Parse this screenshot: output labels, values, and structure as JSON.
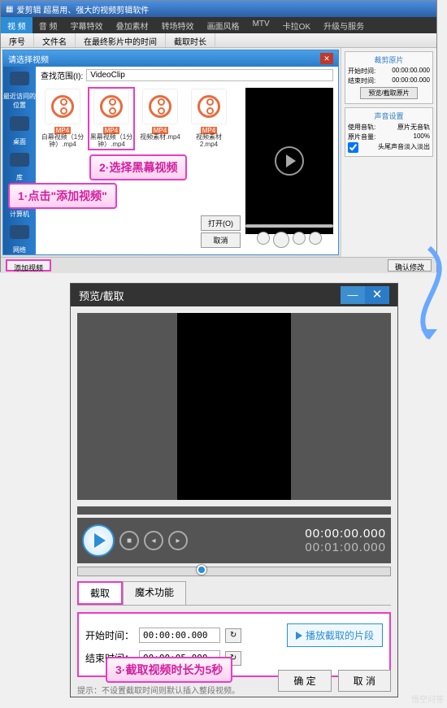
{
  "mainWindow": {
    "title": "爱剪辑  超易用、强大的视频剪辑软件",
    "tabs": [
      "视 频",
      "音 频",
      "字幕特效",
      "叠加素材",
      "转场特效",
      "画面风格",
      "MTV",
      "卡拉OK",
      "升级与服务"
    ],
    "activeTab": 0,
    "subHeaders": [
      "序号",
      "文件名",
      "在最终影片中的时间",
      "截取时长"
    ],
    "dialog": {
      "title": "请选择视频",
      "pathLabel": "查找范围(I):",
      "pathValue": "VideoClip",
      "recentLabel": "最近访问的位置",
      "railItems": [
        "桌面",
        "库",
        "计算机",
        "网络"
      ],
      "openBtn": "打开(O)",
      "cancelBtn": "取消",
      "thumbs": [
        {
          "badge": "MP4",
          "name": "白幕视频（1分钟）.mp4",
          "selected": false
        },
        {
          "badge": "MP4",
          "name": "黑幕视频（1分钟）.mp4",
          "selected": true
        },
        {
          "badge": "MP4",
          "name": "视频素材.mp4",
          "selected": false
        },
        {
          "badge": "MP4",
          "name": "视频素材2.mp4",
          "selected": false
        }
      ]
    },
    "rightPanel": {
      "sec1Title": "裁剪原片",
      "startLabel": "开始时间:",
      "startVal": "00:00:00.000",
      "endLabel": "结束时间:",
      "endVal": "00:00:00.000",
      "trimBtn": "预览/截取原片",
      "sec2Title": "声音设置",
      "useAudio": "使用音轨:",
      "useAudioVal": "原片无音轨",
      "volLabel": "原片音量:",
      "volVal": "100%",
      "fadeLabel": "头尾声音淡入淡出"
    },
    "addVideoBtn": "添加视频",
    "confirmBtn": "确认修改"
  },
  "annotations": {
    "a1": "1·点击\"添加视频\"",
    "a2": "2·选择黑幕视频",
    "a3": "3·截取视频时长为5秒"
  },
  "dialog2": {
    "title": "预览/截取",
    "tc1": "00:00:00.000",
    "tc2": "00:01:00.000",
    "tabs": [
      "截取",
      "魔术功能"
    ],
    "activeTab": 0,
    "startLabel": "开始时间：",
    "startVal": "00:00:00.000",
    "endLabel": "结束时间：",
    "endVal": "00:00:05.000",
    "playSegBtn": "播放截取的片段",
    "tip": "提示：不设置截取时间则默认插入整段视频。",
    "okBtn": "确 定",
    "cancelBtn": "取 消"
  },
  "watermark": "悟空问答"
}
